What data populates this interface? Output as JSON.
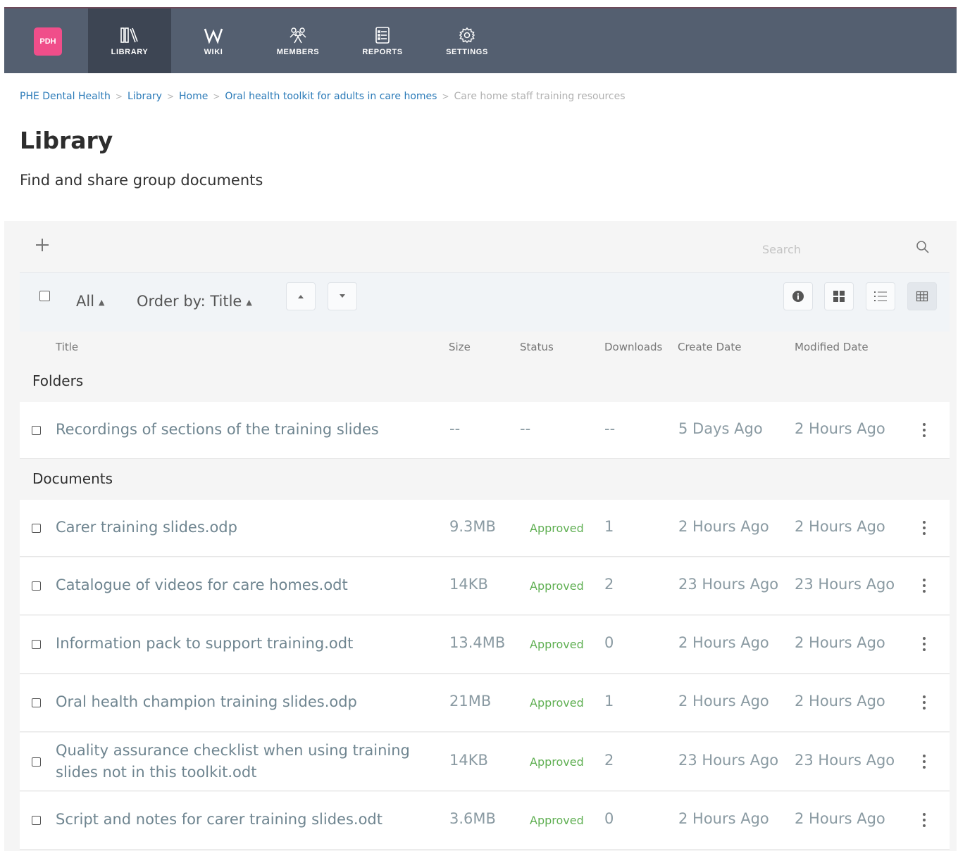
{
  "nav": {
    "logo": "PDH",
    "items": [
      {
        "label": "LIBRARY"
      },
      {
        "label": "WIKI"
      },
      {
        "label": "MEMBERS"
      },
      {
        "label": "REPORTS"
      },
      {
        "label": "SETTINGS"
      }
    ]
  },
  "breadcrumb": [
    "PHE Dental Health",
    "Library",
    "Home",
    "Oral health toolkit for adults in care homes",
    "Care home staff training resources"
  ],
  "page": {
    "title": "Library",
    "subtitle": "Find and share group documents"
  },
  "search": {
    "placeholder": "Search"
  },
  "toolbar": {
    "filter_label": "All",
    "order_label": "Order by: Title"
  },
  "columns": {
    "title": "Title",
    "size": "Size",
    "status": "Status",
    "downloads": "Downloads",
    "created": "Create Date",
    "modified": "Modified Date"
  },
  "sections": {
    "folders": "Folders",
    "documents": "Documents"
  },
  "folders": [
    {
      "title": "Recordings of sections of the training slides",
      "size": "--",
      "status": "--",
      "downloads": "--",
      "created": "5 Days Ago",
      "modified": "2 Hours Ago"
    }
  ],
  "documents": [
    {
      "title": "Carer training slides.odp",
      "size": "9.3MB",
      "status": "Approved",
      "downloads": "1",
      "created": "2 Hours Ago",
      "modified": "2 Hours Ago"
    },
    {
      "title": "Catalogue of videos for care homes.odt",
      "size": "14KB",
      "status": "Approved",
      "downloads": "2",
      "created": "23 Hours Ago",
      "modified": "23 Hours Ago"
    },
    {
      "title": "Information pack to support training.odt",
      "size": "13.4MB",
      "status": "Approved",
      "downloads": "0",
      "created": "2 Hours Ago",
      "modified": "2 Hours Ago"
    },
    {
      "title": "Oral health champion training slides.odp",
      "size": "21MB",
      "status": "Approved",
      "downloads": "1",
      "created": "2 Hours Ago",
      "modified": "2 Hours Ago"
    },
    {
      "title": "Quality assurance checklist when using training slides not in this toolkit.odt",
      "size": "14KB",
      "status": "Approved",
      "downloads": "2",
      "created": "23 Hours Ago",
      "modified": "23 Hours Ago"
    },
    {
      "title": "Script and notes for carer training slides.odt",
      "size": "3.6MB",
      "status": "Approved",
      "downloads": "0",
      "created": "2 Hours Ago",
      "modified": "2 Hours Ago"
    }
  ],
  "colors": {
    "topbar": "#545f70",
    "active_nav": "#3d4553",
    "logo": "#f04e8a",
    "link": "#2a7ab8",
    "approved": "#5faf52"
  }
}
